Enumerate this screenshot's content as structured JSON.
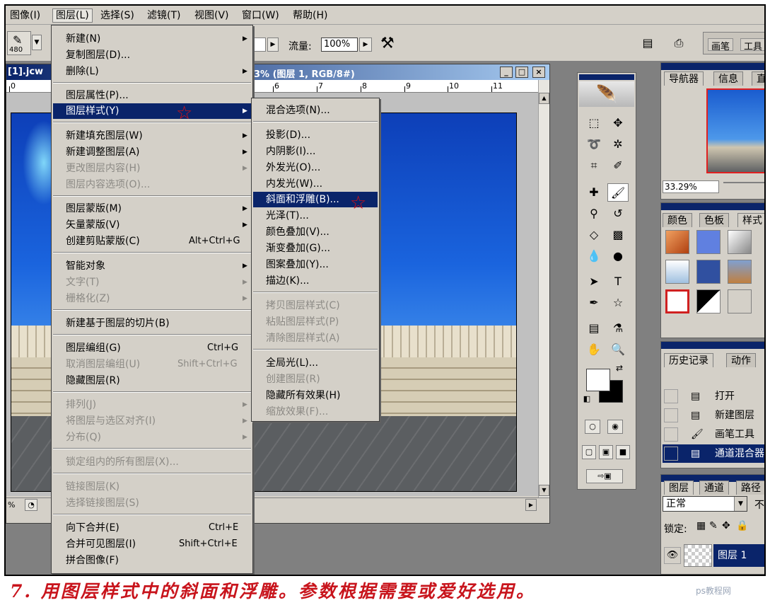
{
  "menubar": {
    "items": [
      "图像(I)",
      "图层(L)",
      "选择(S)",
      "滤镜(T)",
      "视图(V)",
      "窗口(W)",
      "帮助(H)"
    ],
    "open_index": 1
  },
  "options": {
    "preset_number": "480",
    "opacity_partial": "%",
    "flow_label": "流量:",
    "flow_value": "100%"
  },
  "palette_well": {
    "tabs": [
      "画笔",
      "工具"
    ]
  },
  "document": {
    "title_left": "[1].jcw",
    "title_right": "3.3% (图层 1, RGB/8#)",
    "ruler_ticks": [
      "0",
      "6",
      "7",
      "8",
      "9",
      "10",
      "11"
    ],
    "status_zoom": "%"
  },
  "layer_menu": {
    "items": [
      {
        "label": "新建(N)",
        "shortcut": "",
        "arrow": true,
        "disabled": false
      },
      {
        "label": "复制图层(D)...",
        "shortcut": "",
        "arrow": false,
        "disabled": false
      },
      {
        "label": "删除(L)",
        "shortcut": "",
        "arrow": true,
        "disabled": false
      },
      {
        "label": "图层属性(P)...",
        "shortcut": "",
        "arrow": false,
        "disabled": false
      },
      {
        "label": "图层样式(Y)",
        "shortcut": "",
        "arrow": true,
        "disabled": false,
        "selected": true
      },
      {
        "label": "新建填充图层(W)",
        "shortcut": "",
        "arrow": true,
        "disabled": false
      },
      {
        "label": "新建调整图层(A)",
        "shortcut": "",
        "arrow": true,
        "disabled": false
      },
      {
        "label": "更改图层内容(H)",
        "shortcut": "",
        "arrow": true,
        "disabled": true
      },
      {
        "label": "图层内容选项(O)...",
        "shortcut": "",
        "arrow": false,
        "disabled": true
      },
      {
        "label": "图层蒙版(M)",
        "shortcut": "",
        "arrow": true,
        "disabled": false
      },
      {
        "label": "矢量蒙版(V)",
        "shortcut": "",
        "arrow": true,
        "disabled": false
      },
      {
        "label": "创建剪贴蒙版(C)",
        "shortcut": "Alt+Ctrl+G",
        "arrow": false,
        "disabled": false
      },
      {
        "label": "智能对象",
        "shortcut": "",
        "arrow": true,
        "disabled": false
      },
      {
        "label": "文字(T)",
        "shortcut": "",
        "arrow": true,
        "disabled": true
      },
      {
        "label": "栅格化(Z)",
        "shortcut": "",
        "arrow": true,
        "disabled": true
      },
      {
        "label": "新建基于图层的切片(B)",
        "shortcut": "",
        "arrow": false,
        "disabled": false
      },
      {
        "label": "图层编组(G)",
        "shortcut": "Ctrl+G",
        "arrow": false,
        "disabled": false
      },
      {
        "label": "取消图层编组(U)",
        "shortcut": "Shift+Ctrl+G",
        "arrow": false,
        "disabled": true
      },
      {
        "label": "隐藏图层(R)",
        "shortcut": "",
        "arrow": false,
        "disabled": false
      },
      {
        "label": "排列(J)",
        "shortcut": "",
        "arrow": true,
        "disabled": true
      },
      {
        "label": "将图层与选区对齐(I)",
        "shortcut": "",
        "arrow": true,
        "disabled": true
      },
      {
        "label": "分布(Q)",
        "shortcut": "",
        "arrow": true,
        "disabled": true
      },
      {
        "label": "锁定组内的所有图层(X)...",
        "shortcut": "",
        "arrow": false,
        "disabled": true
      },
      {
        "label": "链接图层(K)",
        "shortcut": "",
        "arrow": false,
        "disabled": true
      },
      {
        "label": "选择链接图层(S)",
        "shortcut": "",
        "arrow": false,
        "disabled": true
      },
      {
        "label": "向下合并(E)",
        "shortcut": "Ctrl+E",
        "arrow": false,
        "disabled": false
      },
      {
        "label": "合并可见图层(I)",
        "shortcut": "Shift+Ctrl+E",
        "arrow": false,
        "disabled": false
      },
      {
        "label": "拼合图像(F)",
        "shortcut": "",
        "arrow": false,
        "disabled": false
      }
    ]
  },
  "style_submenu": {
    "items": [
      {
        "label": "混合选项(N)...",
        "disabled": false
      },
      {
        "label": "投影(D)...",
        "disabled": false
      },
      {
        "label": "内阴影(I)...",
        "disabled": false
      },
      {
        "label": "外发光(O)...",
        "disabled": false
      },
      {
        "label": "内发光(W)...",
        "disabled": false
      },
      {
        "label": "斜面和浮雕(B)...",
        "disabled": false,
        "selected": true
      },
      {
        "label": "光泽(T)...",
        "disabled": false
      },
      {
        "label": "颜色叠加(V)...",
        "disabled": false
      },
      {
        "label": "渐变叠加(G)...",
        "disabled": false
      },
      {
        "label": "图案叠加(Y)...",
        "disabled": false
      },
      {
        "label": "描边(K)...",
        "disabled": false
      },
      {
        "label": "拷贝图层样式(C)",
        "disabled": true
      },
      {
        "label": "粘贴图层样式(P)",
        "disabled": true
      },
      {
        "label": "清除图层样式(A)",
        "disabled": true
      },
      {
        "label": "全局光(L)...",
        "disabled": false
      },
      {
        "label": "创建图层(R)",
        "disabled": true
      },
      {
        "label": "隐藏所有效果(H)",
        "disabled": false
      },
      {
        "label": "缩放效果(F)...",
        "disabled": true
      }
    ]
  },
  "navigator_panel": {
    "tabs": [
      "导航器",
      "信息",
      "直"
    ],
    "zoom": "33.29%"
  },
  "styles_panel": {
    "tabs": [
      "颜色",
      "色板",
      "样式"
    ]
  },
  "history_panel": {
    "tabs": [
      "历史记录",
      "动作"
    ],
    "rows": [
      "打开",
      "新建图层",
      "画笔工具",
      "通道混合器"
    ]
  },
  "layers_panel": {
    "tabs": [
      "图层",
      "通道",
      "路径"
    ],
    "blend_mode": "正常",
    "opacity_partial": "不",
    "lock_label": "锁定:",
    "layer_name": "图层 1"
  },
  "caption": "7. 用图层样式中的斜面和浮雕。参数根据需要或爱好选用。",
  "watermark": "ps教程网",
  "colors": {
    "selection": "#0a246a",
    "caption": "#c8141c",
    "star": "#e01010"
  }
}
